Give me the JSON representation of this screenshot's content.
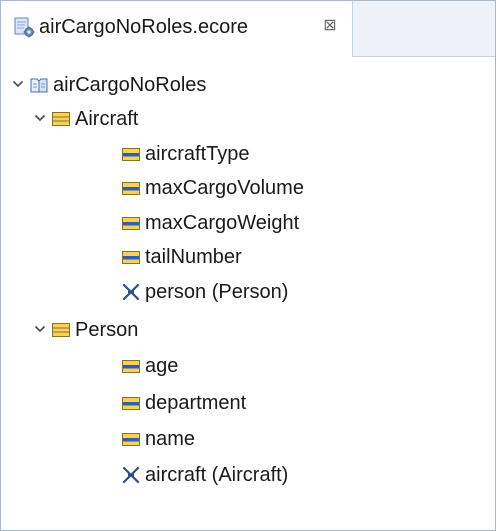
{
  "editor": {
    "tab": {
      "title": "airCargoNoRoles.ecore",
      "close_glyph": "⊠",
      "icon": "ecore-file-icon"
    }
  },
  "tree": {
    "package": {
      "label": "airCargoNoRoles",
      "icon": "epackage-icon",
      "expanded": true
    },
    "classes": [
      {
        "label": "Aircraft",
        "icon": "eclass-icon",
        "expanded": true,
        "children": [
          {
            "label": "aircraftType",
            "icon": "eattribute-icon"
          },
          {
            "label": "maxCargoVolume",
            "icon": "eattribute-icon"
          },
          {
            "label": "maxCargoWeight",
            "icon": "eattribute-icon"
          },
          {
            "label": "tailNumber",
            "icon": "eattribute-icon"
          },
          {
            "label": "person (Person)",
            "icon": "ereference-icon"
          }
        ]
      },
      {
        "label": "Person",
        "icon": "eclass-icon",
        "expanded": true,
        "children": [
          {
            "label": "age",
            "icon": "eattribute-icon"
          },
          {
            "label": "department",
            "icon": "eattribute-icon"
          },
          {
            "label": "name",
            "icon": "eattribute-icon"
          },
          {
            "label": "aircraft (Aircraft)",
            "icon": "ereference-icon"
          }
        ]
      }
    ]
  },
  "colors": {
    "class_icon_fill": "#f5d35b",
    "class_icon_stroke": "#8a7320",
    "attribute_icon_fill": "#f5d35b",
    "attribute_icon_band": "#2e5fb4",
    "reference_icon": "#2c4f86",
    "package_icon": "#4a6ea8"
  }
}
